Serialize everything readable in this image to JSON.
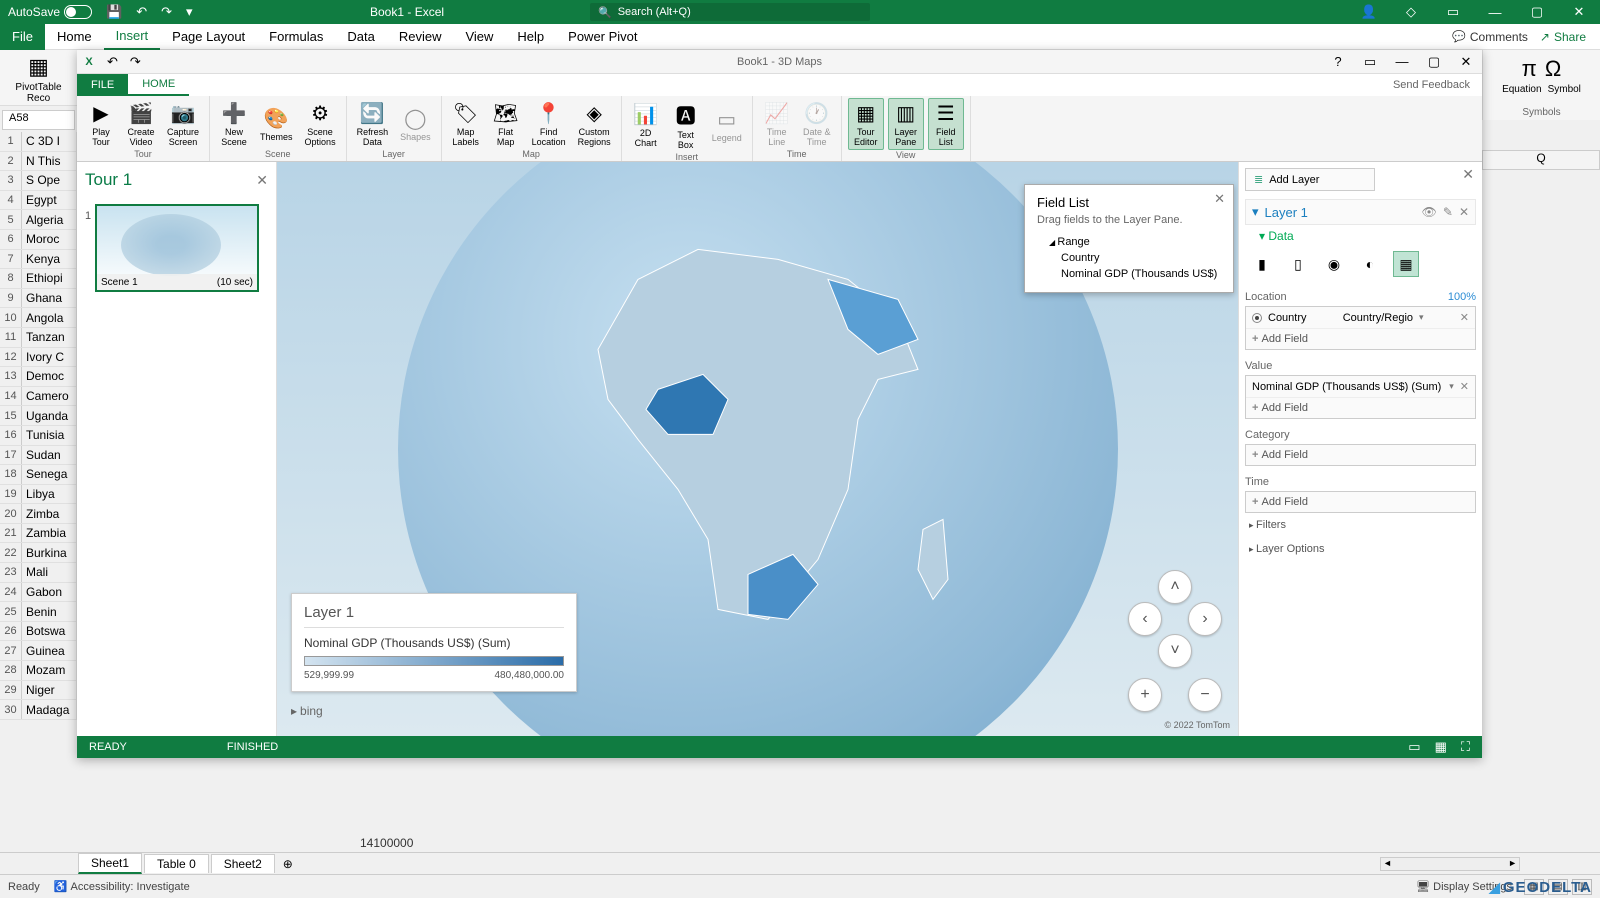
{
  "excel": {
    "title": "Book1 - Excel",
    "autosave_label": "AutoSave",
    "search_placeholder": "Search (Alt+Q)",
    "tabs": {
      "file": "File",
      "home": "Home",
      "insert": "Insert",
      "pagelayout": "Page Layout",
      "formulas": "Formulas",
      "data": "Data",
      "review": "Review",
      "view": "View",
      "help": "Help",
      "powerpivot": "Power Pivot"
    },
    "comments": "Comments",
    "share": "Share",
    "pivot_label": "PivotTable Reco",
    "namebox": "A58",
    "rows": [
      {
        "n": "1",
        "v": "C 3D I"
      },
      {
        "n": "2",
        "v": "N This"
      },
      {
        "n": "3",
        "v": "S Ope"
      },
      {
        "n": "4",
        "v": "Egypt"
      },
      {
        "n": "5",
        "v": "Algeria"
      },
      {
        "n": "6",
        "v": "Moroc"
      },
      {
        "n": "7",
        "v": "Kenya"
      },
      {
        "n": "8",
        "v": "Ethiopi"
      },
      {
        "n": "9",
        "v": "Ghana"
      },
      {
        "n": "10",
        "v": "Angola"
      },
      {
        "n": "11",
        "v": "Tanzan"
      },
      {
        "n": "12",
        "v": "Ivory C"
      },
      {
        "n": "13",
        "v": "Democ"
      },
      {
        "n": "14",
        "v": "Camero"
      },
      {
        "n": "15",
        "v": "Uganda"
      },
      {
        "n": "16",
        "v": "Tunisia"
      },
      {
        "n": "17",
        "v": "Sudan"
      },
      {
        "n": "18",
        "v": "Senega"
      },
      {
        "n": "19",
        "v": "Libya"
      },
      {
        "n": "20",
        "v": "Zimba"
      },
      {
        "n": "21",
        "v": "Zambia"
      },
      {
        "n": "22",
        "v": "Burkina"
      },
      {
        "n": "23",
        "v": "Mali"
      },
      {
        "n": "24",
        "v": "Gabon"
      },
      {
        "n": "25",
        "v": "Benin"
      },
      {
        "n": "26",
        "v": "Botswa"
      },
      {
        "n": "27",
        "v": "Guinea"
      },
      {
        "n": "28",
        "v": "Mozam"
      },
      {
        "n": "29",
        "v": "Niger"
      },
      {
        "n": "30",
        "v": "Madaga"
      }
    ],
    "sheets": {
      "s1": "Sheet1",
      "s2": "Table 0",
      "s3": "Sheet2"
    },
    "status_ready": "Ready",
    "status_acc": "Accessibility: Investigate",
    "display_settings": "Display Settings",
    "equation": "Equation",
    "symbol": "Symbol",
    "symbols_group": "Symbols",
    "q_col": "Q",
    "partial_val": "14100000"
  },
  "maps": {
    "title": "Book1 - 3D Maps",
    "file": "FILE",
    "home": "HOME",
    "feedback": "Send Feedback",
    "ribbon": {
      "play_tour": "Play\nTour",
      "create_video": "Create\nVideo",
      "capture_screen": "Capture\nScreen",
      "tour_group": "Tour",
      "new_scene": "New\nScene",
      "themes": "Themes",
      "scene_options": "Scene\nOptions",
      "scene_group": "Scene",
      "refresh_data": "Refresh\nData",
      "shapes": "Shapes",
      "layer_group": "Layer",
      "map_labels": "Map\nLabels",
      "flat_map": "Flat\nMap",
      "find_location": "Find\nLocation",
      "custom_regions": "Custom\nRegions",
      "map_group": "Map",
      "twod_chart": "2D\nChart",
      "text_box": "Text\nBox",
      "legend": "Legend",
      "insert_group": "Insert",
      "timeline": "Time\nLine",
      "datetime": "Date &\nTime",
      "time_group": "Time",
      "tour_editor": "Tour\nEditor",
      "layer_pane": "Layer\nPane",
      "field_list": "Field\nList",
      "view_group": "View"
    },
    "tour": {
      "title": "Tour 1",
      "scene_num": "1",
      "scene_name": "Scene 1",
      "scene_dur": "(10 sec)"
    },
    "legend": {
      "title": "Layer 1",
      "measure": "Nominal GDP  (Thousands US$) (Sum)",
      "min": "529,999.99",
      "max": "480,480,000.00"
    },
    "bing": "bing",
    "tomtom": "© 2022 TomTom",
    "field_list": {
      "title": "Field List",
      "sub": "Drag fields to the Layer Pane.",
      "range": "Range",
      "f1": "Country",
      "f2": "Nominal GDP  (Thousands US$)"
    },
    "layer_pane": {
      "add_layer": "Add Layer",
      "layer1": "Layer 1",
      "data": "Data",
      "location": "Location",
      "location_pct": "100%",
      "country": "Country",
      "country_type": "Country/Regio",
      "add_field": "Add Field",
      "value": "Value",
      "value_field": "Nominal GDP  (Thousands US$) (Sum)",
      "category": "Category",
      "time": "Time",
      "filters": "Filters",
      "layer_options": "Layer Options"
    },
    "status": {
      "ready": "READY",
      "finished": "FINISHED"
    }
  },
  "brand": "GEODELTA"
}
